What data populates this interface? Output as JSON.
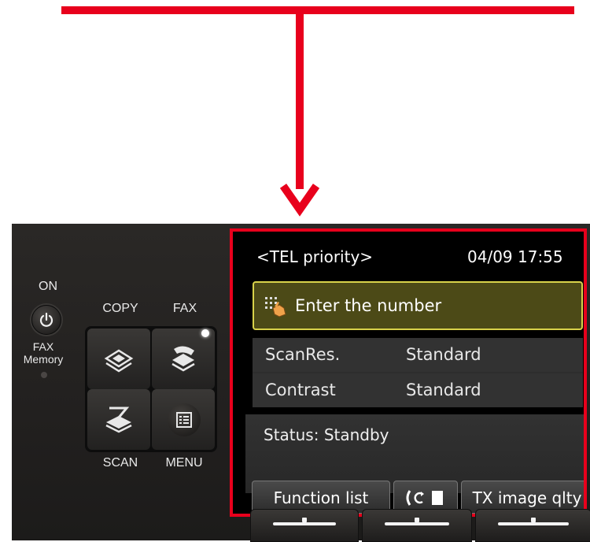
{
  "panel": {
    "on_label": "ON",
    "fax_memory_label": "FAX\nMemory",
    "mode_labels": {
      "copy": "COPY",
      "fax": "FAX",
      "scan": "SCAN",
      "menu": "MENU"
    },
    "icons": {
      "power": "power-icon",
      "copy": "copy-icon",
      "fax": "fax-icon",
      "scan": "scan-icon",
      "menu": "menu-icon"
    }
  },
  "lcd": {
    "mode_indicator": "<TEL priority>",
    "datetime": "04/09 17:55",
    "entry": {
      "icon": "dialpad-hand-icon",
      "text": "Enter the number"
    },
    "settings": [
      {
        "label": "ScanRes.",
        "value": "Standard"
      },
      {
        "label": "Contrast",
        "value": "Standard"
      }
    ],
    "status": "Status: Standby",
    "softkeys": [
      {
        "label": "Function list"
      },
      {
        "label": "",
        "icon": "hook-memory-icon"
      },
      {
        "label": "TX image qlty"
      }
    ]
  },
  "colors": {
    "callout": "#e8001c",
    "entry_border": "#d8d24a",
    "entry_fill": "#4c4a17"
  }
}
